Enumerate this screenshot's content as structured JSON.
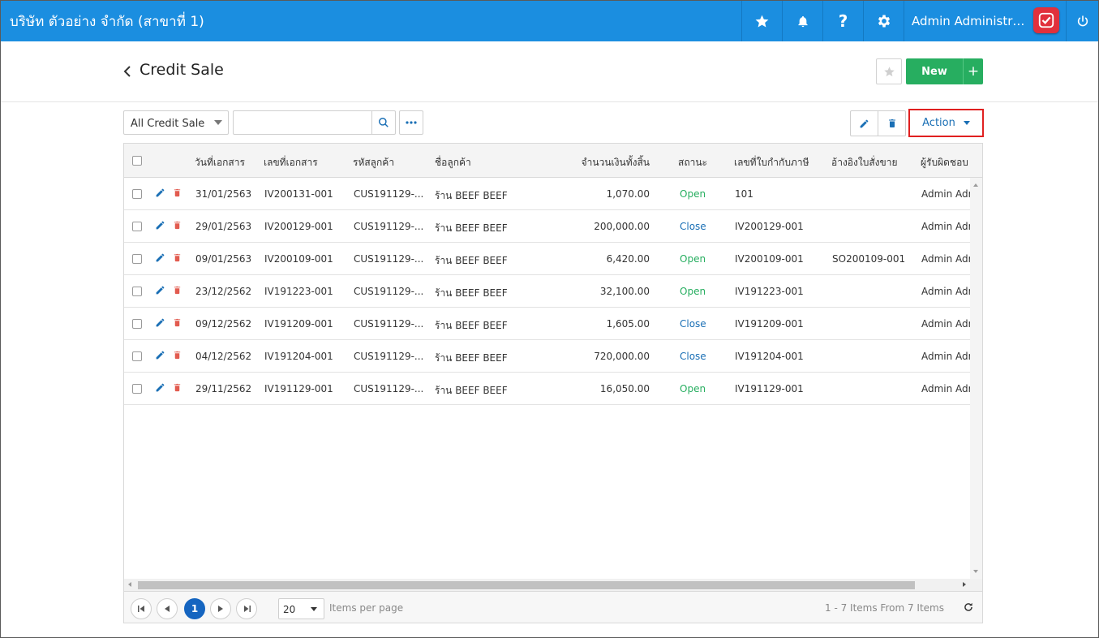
{
  "topbar": {
    "company": "บริษัท ตัวอย่าง จำกัด (สาขาที่ 1)",
    "user": "Admin Administrator",
    "icons": [
      "star-icon",
      "bell-icon",
      "help-icon",
      "gear-icon",
      "power-icon"
    ],
    "color": "#1b8ee0"
  },
  "header": {
    "title": "Credit Sale",
    "new_label": "New",
    "plus_label": "+"
  },
  "toolbar": {
    "filter_value": "All Credit Sale",
    "search_placeholder": "",
    "action_label": "Action"
  },
  "grid": {
    "columns": [
      "วันที่เอกสาร",
      "เลขที่เอกสาร",
      "รหัสลูกค้า",
      "ชื่อลูกค้า",
      "จำนวนเงินทั้งสิ้น",
      "สถานะ",
      "เลขที่ใบกำกับภาษี",
      "อ้างอิงใบสั่งขาย",
      "ผู้รับผิดชอบ"
    ],
    "rows": [
      {
        "date": "31/01/2563",
        "doc_no": "IV200131-001",
        "cust_code": "CUS191129-...",
        "cust_name": "ร้าน BEEF BEEF",
        "amount": "1,070.00",
        "status": "Open",
        "tax_no": "101",
        "so_ref": "",
        "owner": "Admin Adm"
      },
      {
        "date": "29/01/2563",
        "doc_no": "IV200129-001",
        "cust_code": "CUS191129-...",
        "cust_name": "ร้าน BEEF BEEF",
        "amount": "200,000.00",
        "status": "Close",
        "tax_no": "IV200129-001",
        "so_ref": "",
        "owner": "Admin Adm"
      },
      {
        "date": "09/01/2563",
        "doc_no": "IV200109-001",
        "cust_code": "CUS191129-...",
        "cust_name": "ร้าน BEEF BEEF",
        "amount": "6,420.00",
        "status": "Open",
        "tax_no": "IV200109-001",
        "so_ref": "SO200109-001",
        "owner": "Admin Adm"
      },
      {
        "date": "23/12/2562",
        "doc_no": "IV191223-001",
        "cust_code": "CUS191129-...",
        "cust_name": "ร้าน BEEF BEEF",
        "amount": "32,100.00",
        "status": "Open",
        "tax_no": "IV191223-001",
        "so_ref": "",
        "owner": "Admin Adm"
      },
      {
        "date": "09/12/2562",
        "doc_no": "IV191209-001",
        "cust_code": "CUS191129-...",
        "cust_name": "ร้าน BEEF BEEF",
        "amount": "1,605.00",
        "status": "Close",
        "tax_no": "IV191209-001",
        "so_ref": "",
        "owner": "Admin Adm"
      },
      {
        "date": "04/12/2562",
        "doc_no": "IV191204-001",
        "cust_code": "CUS191129-...",
        "cust_name": "ร้าน BEEF BEEF",
        "amount": "720,000.00",
        "status": "Close",
        "tax_no": "IV191204-001",
        "so_ref": "",
        "owner": "Admin Adm"
      },
      {
        "date": "29/11/2562",
        "doc_no": "IV191129-001",
        "cust_code": "CUS191129-...",
        "cust_name": "ร้าน BEEF BEEF",
        "amount": "16,050.00",
        "status": "Open",
        "tax_no": "IV191129-001",
        "so_ref": "",
        "owner": "Admin Adm"
      }
    ],
    "status_colors": {
      "Open": "#27ae60",
      "Close": "#1a6fb5"
    }
  },
  "pager": {
    "current_page": "1",
    "page_size": "20",
    "items_per_page_label": "Items per page",
    "info": "1 - 7 Items From 7 Items"
  }
}
